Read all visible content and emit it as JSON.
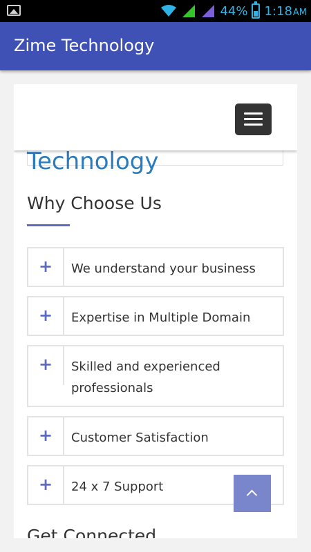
{
  "status_bar": {
    "battery_percent": "44%",
    "time": "1:18",
    "ampm": "AM",
    "icons": [
      "image-icon",
      "wifi-icon",
      "signal-icon",
      "signal-icon",
      "battery-icon"
    ]
  },
  "app_bar": {
    "title": "Zime Technology",
    "color": "#3f51b5"
  },
  "site": {
    "brand": "Zime Technology",
    "menu_icon": "hamburger-menu-icon",
    "section_title": "Why Choose Us",
    "features": [
      {
        "icon": "plus-icon",
        "label": "We understand your business"
      },
      {
        "icon": "plus-icon",
        "label": "Expertise in Multiple Domain"
      },
      {
        "icon": "plus-icon",
        "label": "Skilled and experienced professionals"
      },
      {
        "icon": "plus-icon",
        "label": "Customer Satisfaction"
      },
      {
        "icon": "plus-icon",
        "label": "24 x 7 Support"
      }
    ],
    "next_section_title": "Get Connected",
    "scroll_top_icon": "chevron-up-icon",
    "accent_color": "#5c6bc0",
    "brand_color": "#2b7bbd"
  }
}
